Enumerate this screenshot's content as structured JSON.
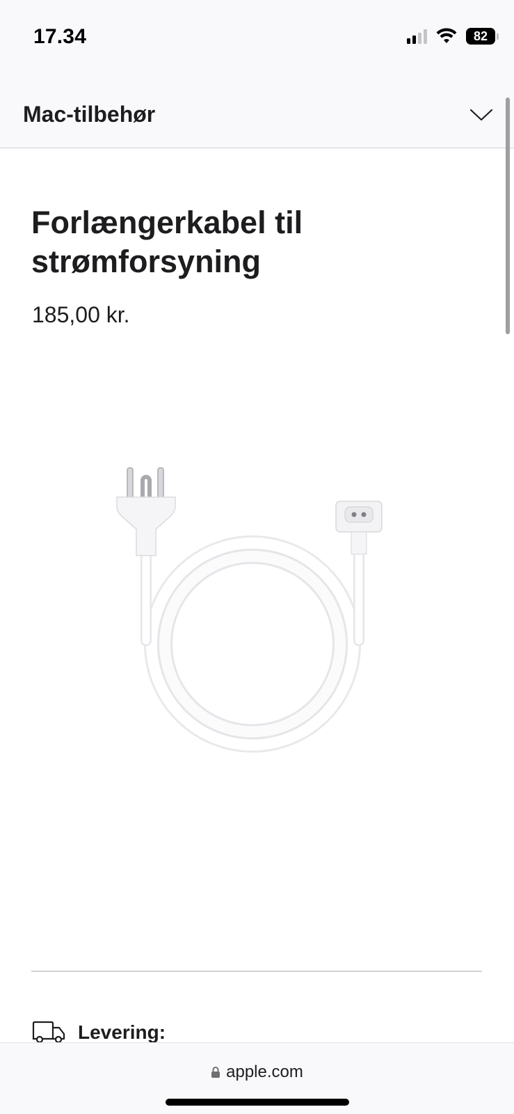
{
  "status_bar": {
    "time": "17.34",
    "battery_level": "82",
    "signal_icon": "cellular-signal-icon",
    "wifi_icon": "wifi-icon"
  },
  "category_nav": {
    "title": "Mac-tilbehør",
    "toggle_icon": "chevron-down-icon"
  },
  "product": {
    "title": "Forlængerkabel til strømforsyning",
    "price": "185,00 kr.",
    "image_icon": "power-extension-cable-image"
  },
  "delivery": {
    "label": "Levering:",
    "icon": "delivery-truck-icon"
  },
  "browser": {
    "url": "apple.com",
    "lock_icon": "lock-icon"
  }
}
